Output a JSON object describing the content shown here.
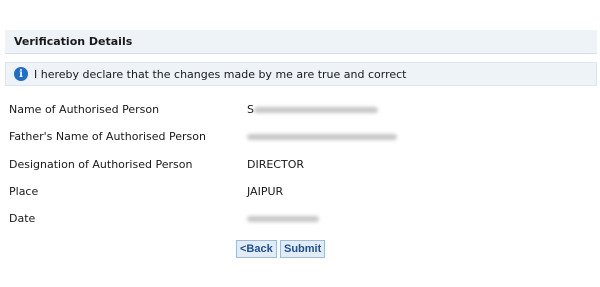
{
  "section": {
    "title": "Verification Details"
  },
  "declaration": {
    "icon": "info-icon",
    "text": "I hereby declare that the changes made by me are true and correct"
  },
  "fields": [
    {
      "label": "Name of Authorised Person",
      "value": "",
      "redacted": true,
      "prefix": "S"
    },
    {
      "label": "Father's Name of Authorised Person",
      "value": "",
      "redacted": true
    },
    {
      "label": "Designation of Authorised Person",
      "value": "DIRECTOR",
      "redacted": false
    },
    {
      "label": "Place",
      "value": "JAIPUR",
      "redacted": false
    },
    {
      "label": "Date",
      "value": "",
      "redacted": true
    }
  ],
  "buttons": {
    "back": "<Back",
    "submit": "Submit"
  },
  "colors": {
    "accent": "#1f6fc8",
    "header_bg": "#eef3f8",
    "button_text": "#1f4f8f"
  }
}
